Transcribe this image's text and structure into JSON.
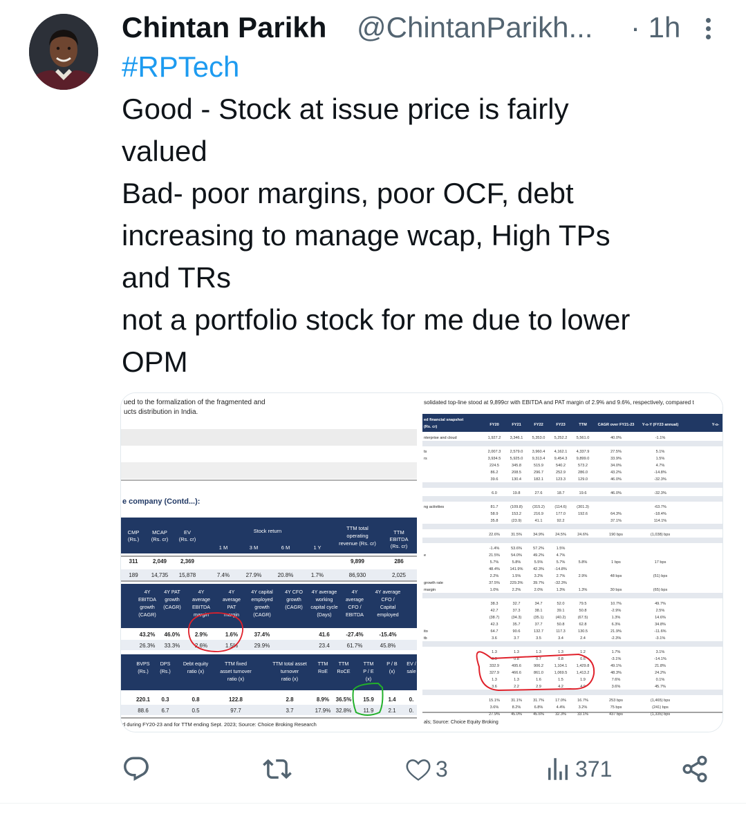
{
  "author": {
    "name": "Chintan Parikh",
    "handle": "@ChintanParikh...",
    "time": "· 1h"
  },
  "tweet": {
    "hashtag": "#RPTech",
    "lines": [
      "Good - Stock at issue price is fairly",
      "valued",
      "Bad- poor margins, poor OCF, debt",
      "increasing to manage wcap, High TPs",
      "and TRs",
      "not a portfolio stock for me due to lower",
      "OPM"
    ]
  },
  "media": {
    "left": {
      "intro_line1": "ued to the formalization of the fragmented and",
      "intro_line2": "ucts distribution in India.",
      "section_title": "e company (Contd...):",
      "t1": {
        "headers": [
          "CMP (Rs.)",
          "MCAP (Rs. cr)",
          "EV (Rs. cr)",
          "Stock return",
          "TTM total operating revenue (Rs. cr)",
          "TTM EBITDA (Rs. cr)"
        ],
        "subheaders": [
          "1 M",
          "3 M",
          "6 M",
          "1 Y"
        ],
        "rows": [
          [
            "311",
            "2,049",
            "2,369",
            "",
            "",
            "",
            "",
            "9,899",
            "286"
          ],
          [
            "189",
            "14,735",
            "15,878",
            "7.4%",
            "27.9%",
            "20.8%",
            "1.7%",
            "86,930",
            "2,025"
          ]
        ]
      },
      "t2": {
        "headers": [
          "4Y EBITDA growth (CAGR)",
          "4Y PAT growth (CAGR)",
          "4Y average EBITDA margin",
          "4Y average PAT margin",
          "4Y capital employed growth (CAGR)",
          "4Y CFO growth (CAGR)",
          "4Y average working capital cycle (Days)",
          "4Y average CFO / EBITDA",
          "4Y average CFO / Capital employed"
        ],
        "rows": [
          [
            "43.2%",
            "46.0%",
            "2.9%",
            "1.6%",
            "37.4%",
            "",
            "41.6",
            "-27.4%",
            "-15.4%"
          ],
          [
            "26.3%",
            "33.3%",
            "2.6%",
            "1.5%",
            "29.9%",
            "",
            "23.4",
            "61.7%",
            "45.8%"
          ]
        ]
      },
      "t3": {
        "headers": [
          "BVPS (Rs.)",
          "DPS (Rs.)",
          "Debt equity ratio (x)",
          "TTM fixed asset turnover ratio (x)",
          "TTM total asset turnover ratio (x)",
          "TTM RoE",
          "TTM RoCE",
          "TTM P / E (x)",
          "P / B (x)",
          "EV / sale"
        ],
        "rows": [
          [
            "220.1",
            "0.3",
            "0.8",
            "122.8",
            "2.8",
            "8.9%",
            "36.5%",
            "15.9",
            "1.4",
            "0."
          ],
          [
            "88.6",
            "6.7",
            "0.5",
            "97.7",
            "3.7",
            "17.9%",
            "32.8%",
            "11.9",
            "2.1",
            "0."
          ]
        ]
      },
      "footnote": "d during FY20-23 and for TTM ending Sept. 2023; Source: Choice Broking Research"
    },
    "right": {
      "intro": "solidated top-line stood at 9,899cr with EBITDA and PAT margin of 2.9% and 9.6%, respectively, compared t",
      "headers": [
        "ed financial snapshot (Rs. cr)",
        "FY20",
        "FY21",
        "FY22",
        "FY23",
        "TTM",
        "CAGR over FY21-23",
        "Y-o-Y (FY23 annual)",
        "Y-o-"
      ],
      "rows": [
        [
          "nterprise and cloud",
          "1,927.2",
          "3,346.1",
          "5,353.0",
          "5,252.2",
          "5,561.0",
          "40.0%",
          "-1.1%"
        ],
        [
          "",
          "",
          "",
          "",
          "",
          "",
          "",
          ""
        ],
        [
          "ts",
          "2,007.3",
          "2,579.0",
          "3,960.4",
          "4,162.1",
          "4,337.9",
          "27.5%",
          "5.1%"
        ],
        [
          "rs",
          "3,934.5",
          "5,925.0",
          "9,313.4",
          "9,454.3",
          "9,899.0",
          "33.9%",
          "1.5%"
        ],
        [
          "",
          "224.5",
          "345.8",
          "515.9",
          "540.2",
          "573.2",
          "34.0%",
          "4.7%"
        ],
        [
          "",
          "86.2",
          "208.5",
          "296.7",
          "252.9",
          "286.0",
          "43.2%",
          "-14.8%"
        ],
        [
          "",
          "39.6",
          "130.4",
          "182.1",
          "123.3",
          "129.0",
          "46.0%",
          "-32.3%"
        ],
        [
          "",
          "",
          "",
          "",
          "",
          "",
          "",
          ""
        ],
        [
          "",
          "6.0",
          "19.8",
          "27.6",
          "18.7",
          "19.6",
          "46.0%",
          "-32.3%"
        ],
        [
          "",
          "",
          "",
          "",
          "",
          "",
          "",
          ""
        ],
        [
          "ng activities",
          "81.7",
          "(109.8)",
          "(315.2)",
          "(114.6)",
          "(301.3)",
          "",
          "-63.7%"
        ],
        [
          "",
          "58.9",
          "153.2",
          "216.9",
          "177.0",
          "192.6",
          "64.3%",
          "-18.4%"
        ],
        [
          "",
          "35.8",
          "(23.9)",
          "41.1",
          "92.2",
          "",
          "37.1%",
          "114.1%"
        ],
        [
          "",
          "",
          "",
          "",
          "",
          "",
          "",
          ""
        ],
        [
          "",
          "22.6%",
          "31.5%",
          "34.9%",
          "24.5%",
          "24.6%",
          "190 bps",
          "(1,038) bps"
        ],
        [
          "",
          "",
          "",
          "",
          "",
          "",
          "",
          ""
        ],
        [
          "",
          "-1.4%",
          "53.6%",
          "57.2%",
          "1.5%",
          "",
          "",
          ""
        ],
        [
          "e",
          "21.5%",
          "54.0%",
          "49.2%",
          "4.7%",
          "",
          "",
          ""
        ],
        [
          "",
          "5.7%",
          "5.8%",
          "5.5%",
          "5.7%",
          "5.8%",
          "1 bps",
          "17 bps"
        ],
        [
          "",
          "48.4%",
          "141.9%",
          "42.3%",
          "-14.8%",
          "",
          "",
          ""
        ],
        [
          "",
          "2.2%",
          "1.5%",
          "3.2%",
          "2.7%",
          "2.9%",
          "48 bps",
          "(51) bps"
        ],
        [
          "growth rate",
          "37.5%",
          "229.3%",
          "39.7%",
          "-32.3%",
          "",
          "",
          ""
        ],
        [
          "margin",
          "1.0%",
          "2.2%",
          "2.0%",
          "1.3%",
          "1.3%",
          "30 bps",
          "(65) bps"
        ],
        [
          "",
          "",
          "",
          "",
          "",
          "",
          "",
          ""
        ],
        [
          "",
          "38.3",
          "32.7",
          "34.7",
          "52.0",
          "79.5",
          "10.7%",
          "49.7%"
        ],
        [
          "",
          "42.7",
          "37.3",
          "38.1",
          "39.1",
          "50.8",
          "-2.9%",
          "2.5%"
        ],
        [
          "",
          "(38.7)",
          "(34.3)",
          "(35.1)",
          "(40.2)",
          "(67.5)",
          "1.3%",
          "14.6%"
        ],
        [
          "",
          "42.3",
          "35.7",
          "37.7",
          "50.8",
          "62.8",
          "6.3%",
          "34.8%"
        ],
        [
          "ito",
          "64.7",
          "90.6",
          "132.7",
          "117.3",
          "130.5",
          "21.9%",
          "-11.6%"
        ],
        [
          "tb",
          "3.6",
          "3.7",
          "3.5",
          "3.4",
          "2.4",
          "-2.3%",
          "-3.1%"
        ],
        [
          "",
          "",
          "",
          "",
          "",
          "",
          "",
          ""
        ],
        [
          "",
          "1.3",
          "1.3",
          "1.3",
          "1.3",
          "1.2",
          "1.7%",
          "3.1%"
        ],
        [
          "",
          "0.9",
          "0.8",
          "0.7",
          "0.8",
          "0.6",
          "-3.1%",
          "-14.1%"
        ],
        [
          "",
          "332.9",
          "495.6",
          "906.2",
          "1,104.1",
          "1,429.8",
          "49.1%",
          "21.8%"
        ],
        [
          "",
          "327.9",
          "466.6",
          "861.0",
          "1,069.5",
          "1,413.2",
          "48.3%",
          "24.2%"
        ],
        [
          "",
          "1.3",
          "1.3",
          "1.6",
          "1.5",
          "1.9",
          "7.6%",
          "0.1%"
        ],
        [
          "",
          "3.6",
          "2.2",
          "2.9",
          "4.2",
          "4.9",
          "3.6%",
          "45.7%"
        ],
        [
          "",
          "",
          "",
          "",
          "",
          "",
          "",
          ""
        ],
        [
          "",
          "15.1%",
          "31.1%",
          "31.7%",
          "17.0%",
          "16.7%",
          "253 bps",
          "(1,465) bps"
        ],
        [
          "",
          "3.6%",
          "8.2%",
          "6.8%",
          "4.4%",
          "3.2%",
          "75 bps",
          "(241) bps"
        ],
        [
          "",
          "27.9%",
          "45.0%",
          "45.6%",
          "32.3%",
          "33.1%",
          "437 bps",
          "(1,335) bps"
        ]
      ],
      "source": "als; Source: Choice Equity Broking"
    }
  },
  "actions": {
    "reply_count": "",
    "retweet_count": "",
    "like_count": "3",
    "views_count": "371"
  },
  "colors": {
    "accent": "#1d9bf0",
    "secondary_text": "#536471",
    "table_header": "#203864",
    "annotation_red": "#e0202a",
    "annotation_green": "#22b02a"
  },
  "icons": [
    "more-icon",
    "reply-icon",
    "retweet-icon",
    "like-icon",
    "views-icon",
    "share-icon"
  ]
}
